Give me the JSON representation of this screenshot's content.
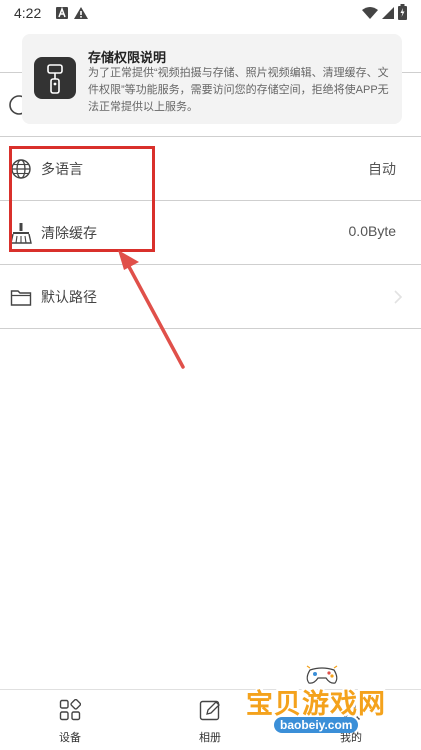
{
  "status_bar": {
    "time": "4:22",
    "icons_left": [
      "notification-a-icon",
      "warning-icon"
    ],
    "icons_right": [
      "wifi-icon",
      "signal-icon",
      "battery-icon"
    ]
  },
  "permission_dialog": {
    "title": "存储权限说明",
    "description": "为了正常提供“视频拍摄与存储、照片视频编辑、清理缓存、文件权限”等功能服务，需要访问您的存储空间，拒绝将使APP无法正常提供以上服务。"
  },
  "settings": {
    "language": {
      "label": "多语言",
      "value": "自动"
    },
    "clear_cache": {
      "label": "清除缓存",
      "value": "0.0Byte"
    },
    "default_path": {
      "label": "默认路径"
    }
  },
  "bottom_nav": {
    "items": [
      {
        "label": "设备"
      },
      {
        "label": "相册"
      },
      {
        "label": "我的"
      }
    ]
  },
  "watermark": {
    "text": "宝贝游戏网",
    "url": "baobeiy.com"
  },
  "colors": {
    "annotation": "#d9302b",
    "divider": "#cfcfcf",
    "watermark_orange": "#f4a21c",
    "watermark_blue": "#3b8fd8"
  }
}
